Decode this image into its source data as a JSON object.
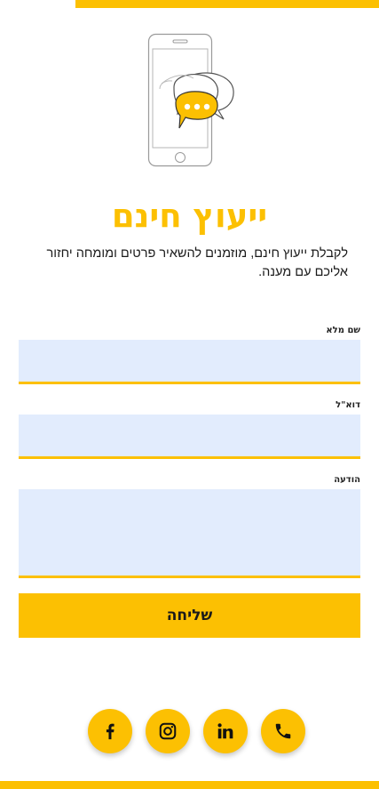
{
  "colors": {
    "accent": "#fcc002",
    "field_background": "#e2ecfd",
    "text": "#1a1a1a"
  },
  "header": {
    "illustration_icon": "phone-with-chat-bubbles-icon",
    "title": "ייעוץ חינם",
    "intro": "לקבלת ייעוץ חינם, מוזמנים להשאיר פרטים ומומחה יחזור אליכם עם מענה."
  },
  "form": {
    "fields": [
      {
        "label": "שם מלא",
        "value": ""
      },
      {
        "label": "דוא\"ל",
        "value": ""
      },
      {
        "label": "הודעה",
        "value": ""
      }
    ],
    "submit_label": "שליחה"
  },
  "social": [
    {
      "icon": "facebook-icon"
    },
    {
      "icon": "instagram-icon"
    },
    {
      "icon": "linkedin-icon"
    },
    {
      "icon": "phone-icon"
    }
  ]
}
